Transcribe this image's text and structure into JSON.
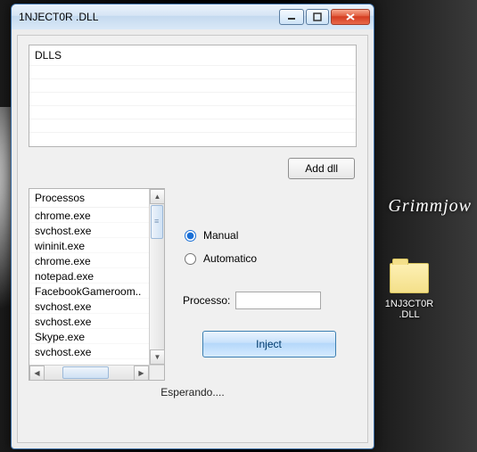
{
  "window": {
    "title": "1NJECT0R .DLL"
  },
  "dlls": {
    "header": "DLLS"
  },
  "buttons": {
    "add_dll": "Add dll",
    "inject": "Inject"
  },
  "process_panel": {
    "header": "Processos",
    "items": [
      "chrome.exe",
      "svchost.exe",
      "wininit.exe",
      "chrome.exe",
      "notepad.exe",
      "FacebookGameroom..",
      "svchost.exe",
      "svchost.exe",
      "Skype.exe",
      "svchost.exe"
    ]
  },
  "mode": {
    "manual": "Manual",
    "automatico": "Automatico",
    "selected": "manual"
  },
  "process_field": {
    "label": "Processo:",
    "value": ""
  },
  "status": "Esperando....",
  "desktop": {
    "watermark": "Grimmjow",
    "folder_label": "1NJ3CT0R .DLL"
  }
}
